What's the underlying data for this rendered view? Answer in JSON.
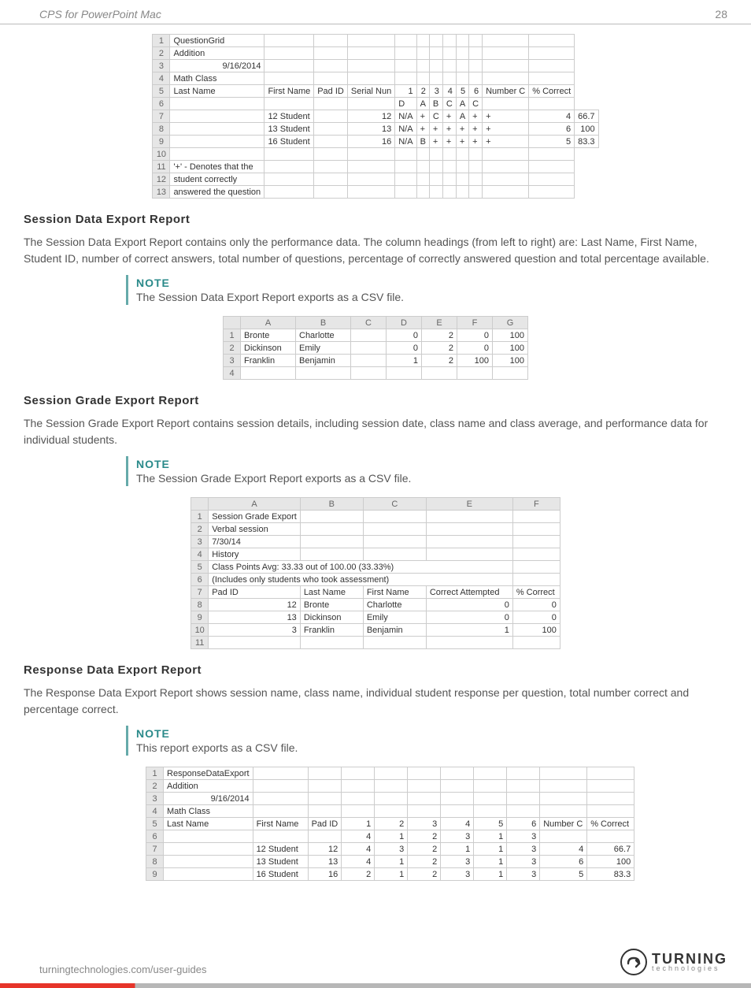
{
  "header": {
    "title": "CPS for PowerPoint Mac",
    "page": "28"
  },
  "table1": {
    "rows": [
      [
        "QuestionGrid",
        "",
        "",
        "",
        "",
        "",
        "",
        "",
        "",
        "",
        "",
        ""
      ],
      [
        "Addition",
        "",
        "",
        "",
        "",
        "",
        "",
        "",
        "",
        "",
        "",
        ""
      ],
      [
        "9/16/2014",
        "",
        "",
        "",
        "",
        "",
        "",
        "",
        "",
        "",
        "",
        ""
      ],
      [
        "Math Class",
        "",
        "",
        "",
        "",
        "",
        "",
        "",
        "",
        "",
        "",
        ""
      ],
      [
        "Last Name",
        "First Name",
        "Pad ID",
        "Serial Nun",
        "1",
        "2",
        "3",
        "4",
        "5",
        "6",
        "Number C",
        "% Correct"
      ],
      [
        "",
        "",
        "",
        "",
        "D",
        "A",
        "B",
        "C",
        "A",
        "C",
        "",
        ""
      ],
      [
        "",
        "12 Student",
        "",
        "12",
        "N/A",
        "+",
        "C",
        "+",
        "A",
        "+",
        "+",
        "4",
        "66.7"
      ],
      [
        "",
        "13 Student",
        "",
        "13",
        "N/A",
        "+",
        "+",
        "+",
        "+",
        "+",
        "+",
        "6",
        "100"
      ],
      [
        "",
        "16 Student",
        "",
        "16",
        "N/A",
        "B",
        "+",
        "+",
        "+",
        "+",
        "+",
        "5",
        "83.3"
      ],
      [
        "",
        "",
        "",
        "",
        "",
        "",
        "",
        "",
        "",
        "",
        "",
        ""
      ],
      [
        "'+' - Denotes that the",
        "",
        "",
        "",
        "",
        "",
        "",
        "",
        "",
        "",
        "",
        ""
      ],
      [
        "student correctly",
        "",
        "",
        "",
        "",
        "",
        "",
        "",
        "",
        "",
        "",
        ""
      ],
      [
        "answered the question",
        "",
        "",
        "",
        "",
        "",
        "",
        "",
        "",
        "",
        "",
        ""
      ]
    ]
  },
  "sec1": {
    "title": "Session Data Export Report",
    "body": "The Session Data Export Report contains only the performance data. The column headings (from left to right) are: Last Name, First Name, Student ID, number of correct answers, total number of questions, percentage of correctly answered question and total percentage available.",
    "note_title": "NOTE",
    "note_body": "The Session Data Export Report exports as a CSV file."
  },
  "table2": {
    "cols": [
      "",
      "A",
      "B",
      "C",
      "D",
      "E",
      "F",
      "G"
    ],
    "rows": [
      [
        "1",
        "Bronte",
        "Charlotte",
        "",
        "0",
        "2",
        "0",
        "100"
      ],
      [
        "2",
        "Dickinson",
        "Emily",
        "",
        "0",
        "2",
        "0",
        "100"
      ],
      [
        "3",
        "Franklin",
        "Benjamin",
        "",
        "1",
        "2",
        "100",
        "100"
      ],
      [
        "4",
        "",
        "",
        "",
        "",
        "",
        "",
        ""
      ]
    ]
  },
  "sec2": {
    "title": "Session Grade Export Report",
    "body": "The Session Grade Export Report contains session details, including session date, class name and class average, and performance data for individual students.",
    "note_title": "NOTE",
    "note_body": "The Session Grade Export Report exports as a CSV file."
  },
  "table3": {
    "cols": [
      "",
      "A",
      "B",
      "C",
      "E",
      "F"
    ],
    "rows": [
      [
        "1",
        "Session Grade Export",
        "",
        "",
        "",
        ""
      ],
      [
        "2",
        "Verbal session",
        "",
        "",
        "",
        ""
      ],
      [
        "3",
        "7/30/14",
        "",
        "",
        "",
        ""
      ],
      [
        "4",
        "History",
        "",
        "",
        "",
        ""
      ],
      [
        "5",
        "Class Points Avg: 33.33 out of 100.00 (33.33%)",
        "",
        "",
        "",
        ""
      ],
      [
        "6",
        "(Includes only students who took assessment)",
        "",
        "",
        "",
        ""
      ],
      [
        "7",
        "Pad ID",
        "Last Name",
        "First Name",
        "Correct Attempted",
        "% Correct"
      ],
      [
        "8",
        "12",
        "Bronte",
        "Charlotte",
        "0",
        "0"
      ],
      [
        "9",
        "13",
        "Dickinson",
        "Emily",
        "0",
        "0"
      ],
      [
        "10",
        "3",
        "Franklin",
        "Benjamin",
        "1",
        "100"
      ],
      [
        "11",
        "",
        "",
        "",
        "",
        ""
      ]
    ]
  },
  "sec3": {
    "title": "Response Data Export Report",
    "body": "The Response Data Export Report shows session name, class name, individual student response per question, total number correct and percentage correct.",
    "note_title": "NOTE",
    "note_body": "This report exports as a CSV file."
  },
  "table4": {
    "rows": [
      [
        "1",
        "ResponseDataExport",
        "",
        "",
        "",
        "",
        "",
        "",
        "",
        "",
        "",
        ""
      ],
      [
        "2",
        "Addition",
        "",
        "",
        "",
        "",
        "",
        "",
        "",
        "",
        "",
        ""
      ],
      [
        "3",
        "9/16/2014",
        "",
        "",
        "",
        "",
        "",
        "",
        "",
        "",
        "",
        ""
      ],
      [
        "4",
        "Math Class",
        "",
        "",
        "",
        "",
        "",
        "",
        "",
        "",
        "",
        ""
      ],
      [
        "5",
        "Last Name",
        "First Name",
        "Pad ID",
        "1",
        "2",
        "3",
        "4",
        "5",
        "6",
        "Number C",
        "% Correct"
      ],
      [
        "6",
        "",
        "",
        "",
        "4",
        "1",
        "2",
        "3",
        "1",
        "3",
        "",
        ""
      ],
      [
        "7",
        "",
        "12 Student",
        "12",
        "4",
        "3",
        "2",
        "1",
        "1",
        "3",
        "4",
        "66.7"
      ],
      [
        "8",
        "",
        "13 Student",
        "13",
        "4",
        "1",
        "2",
        "3",
        "1",
        "3",
        "6",
        "100"
      ],
      [
        "9",
        "",
        "16 Student",
        "16",
        "2",
        "1",
        "2",
        "3",
        "1",
        "3",
        "5",
        "83.3"
      ]
    ]
  },
  "footer": {
    "link": "turningtechnologies.com/user-guides",
    "brand_big": "TURNING",
    "brand_small": "technologies"
  }
}
